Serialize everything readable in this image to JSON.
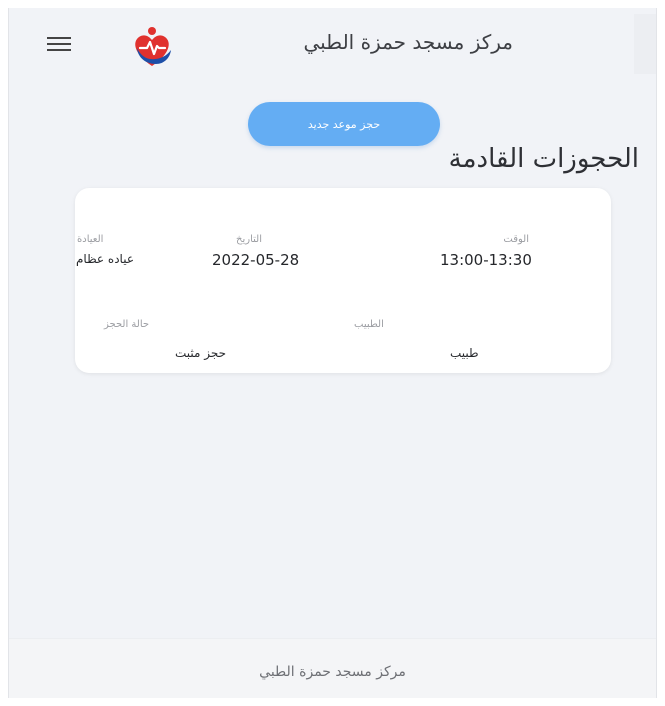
{
  "header": {
    "title": "مركز مسجد حمزة الطبي",
    "menu_icon": "hamburger-icon",
    "logo_icon": "heart-pulse-logo"
  },
  "booking_button": {
    "label": "حجز موعد جديد",
    "color": "#64adf3"
  },
  "section": {
    "title": "الحجوزات القادمة"
  },
  "appointment": {
    "time_label": "الوقت",
    "time_value": "13:00-13:30",
    "date_label": "التاريخ",
    "date_value": "2022-05-28",
    "clinic_label": "العيادة",
    "clinic_value": "عياده عظام",
    "doctor_label": "الطبيب",
    "doctor_value": "طبيب",
    "status_label": "حالة الحجز",
    "status_value": "حجز مثبت"
  },
  "footer": {
    "text": "مركز مسجد حمزة الطبي"
  },
  "colors": {
    "background": "#f1f3f7",
    "accent": "#64adf3",
    "logo_red": "#e0312e",
    "logo_blue": "#1e4fa8"
  }
}
